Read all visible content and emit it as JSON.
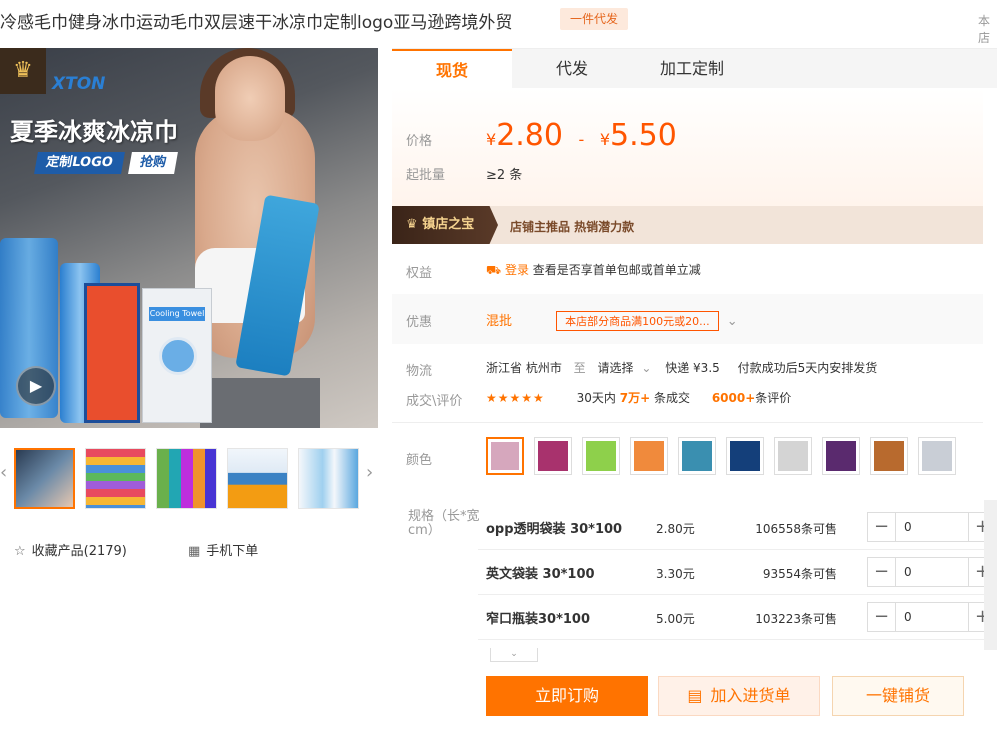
{
  "header": {
    "title": "冷感毛巾健身冰巾运动毛巾双层速干冰凉巾定制logo亚马逊跨境外贸",
    "badge": "一件代发",
    "corner": "本店"
  },
  "gallery": {
    "brand": "XTON",
    "headline": "夏季冰爽冰凉巾",
    "logo_tag": "定制LOGO",
    "buy_tag": "抢购",
    "pack_label": "Cooling Towel",
    "thumbnails": [
      {
        "color": "#4b6e8f"
      },
      {
        "color": "#c98a5a"
      },
      {
        "color": "#5fa06a"
      },
      {
        "color": "#3c7bc0"
      },
      {
        "color": "#8fb0d0"
      }
    ]
  },
  "actions_left": {
    "favorite": "收藏产品(2179)",
    "mobile_order": "手机下单"
  },
  "tabs": [
    {
      "label": "现货",
      "active": true
    },
    {
      "label": "代发",
      "active": false
    },
    {
      "label": "加工定制",
      "active": false
    }
  ],
  "pricing": {
    "price_label": "价格",
    "currency": "¥",
    "price_low": "2.80",
    "separator": "-",
    "price_high": "5.50",
    "moq_label": "起批量",
    "moq_value": "≥2 条"
  },
  "treasure": {
    "title": "镇店之宝",
    "text": "店铺主推品   热销潜力款"
  },
  "rights": {
    "label": "权益",
    "login": "登录",
    "text": "查看是否享首单包邮或首单立减"
  },
  "discount": {
    "label": "优惠",
    "link": "混批",
    "chip": "本店部分商品满100元或20..."
  },
  "logistics": {
    "label": "物流",
    "from": "浙江省 杭州市",
    "to_word": "至",
    "to": "请选择",
    "express": "快递 ¥3.5",
    "note": "付款成功后5天内安排发货",
    "deal_label": "成交\\评价",
    "stars": "★★★★★",
    "deal_prefix": "30天内",
    "deal_count": "7万+",
    "deal_suffix": "条成交",
    "review_count": "6000+",
    "review_suffix": "条评价"
  },
  "color_option": {
    "label": "颜色",
    "swatches": [
      "#d6a7bd",
      "#a8326d",
      "#8ed04b",
      "#f08a3c",
      "#3a8fb0",
      "#143f7a",
      "#d4d4d4",
      "#5a2a6e",
      "#b86a2e",
      "#c9ced6"
    ]
  },
  "specs": {
    "label": "规格（长*宽cm）",
    "rows": [
      {
        "name": "opp透明袋装 30*100",
        "price": "2.80元",
        "stock": "106558条可售",
        "qty": "0"
      },
      {
        "name": "英文袋装 30*100",
        "price": "3.30元",
        "stock": "93554条可售",
        "qty": "0"
      },
      {
        "name": "窄口瓶装30*100",
        "price": "5.00元",
        "stock": "103223条可售",
        "qty": "0"
      }
    ]
  },
  "buttons": {
    "order": "立即订购",
    "cart": "加入进货单",
    "list": "一键铺货"
  },
  "colors": {
    "accent": "#ff7300",
    "price": "#ff5500"
  }
}
